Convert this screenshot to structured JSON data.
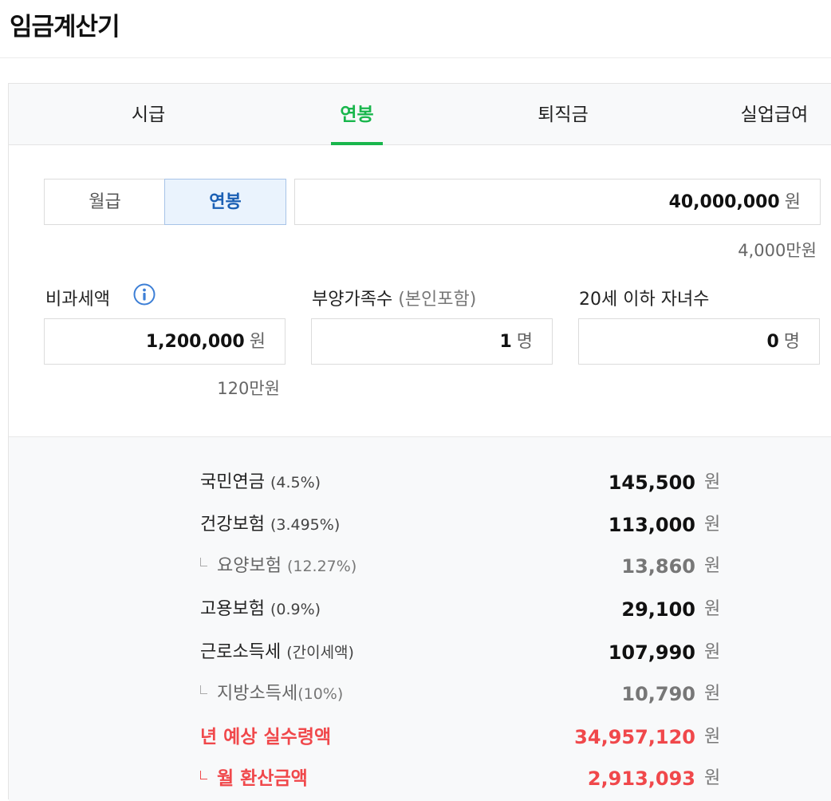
{
  "page": {
    "title": "임금계산기"
  },
  "tabs": [
    {
      "label": "시급",
      "active": false
    },
    {
      "label": "연봉",
      "active": true
    },
    {
      "label": "퇴직금",
      "active": false
    },
    {
      "label": "실업급여",
      "active": false
    }
  ],
  "salary_type": {
    "monthly_label": "월급",
    "annual_label": "연봉",
    "selected": "연봉"
  },
  "salary_input": {
    "value": "40,000,000",
    "unit": "원",
    "helper": "4,000만원"
  },
  "non_taxable": {
    "label": "비과세액",
    "value": "1,200,000",
    "unit": "원",
    "helper": "120만원",
    "icon": "info-icon"
  },
  "dependents": {
    "label": "부양가족수",
    "sublabel": "(본인포함)",
    "value": "1",
    "unit": "명"
  },
  "children": {
    "label": "20세 이하 자녀수",
    "value": "0",
    "unit": "명"
  },
  "results": [
    {
      "label": "국민연금",
      "rate": "(4.5%)",
      "value": "145,500",
      "unit": "원"
    },
    {
      "label": "건강보험",
      "rate": "(3.495%)",
      "value": "113,000",
      "unit": "원"
    },
    {
      "label": "요양보험",
      "rate": "(12.27%)",
      "value": "13,860",
      "unit": "원"
    },
    {
      "label": "고용보험",
      "rate": "(0.9%)",
      "value": "29,100",
      "unit": "원"
    },
    {
      "label": "근로소득세",
      "rate": "(간이세액)",
      "value": "107,990",
      "unit": "원"
    },
    {
      "label": "지방소득세",
      "rate": "(10%)",
      "value": "10,790",
      "unit": "원"
    },
    {
      "label": "년 예상 실수령액",
      "rate": "",
      "value": "34,957,120",
      "unit": "원"
    },
    {
      "label": "월 환산금액",
      "rate": "",
      "value": "2,913,093",
      "unit": "원"
    }
  ],
  "colors": {
    "accent_green": "#19b64c",
    "accent_blue": "#1a5fb4",
    "highlight_red": "#f0484b"
  }
}
